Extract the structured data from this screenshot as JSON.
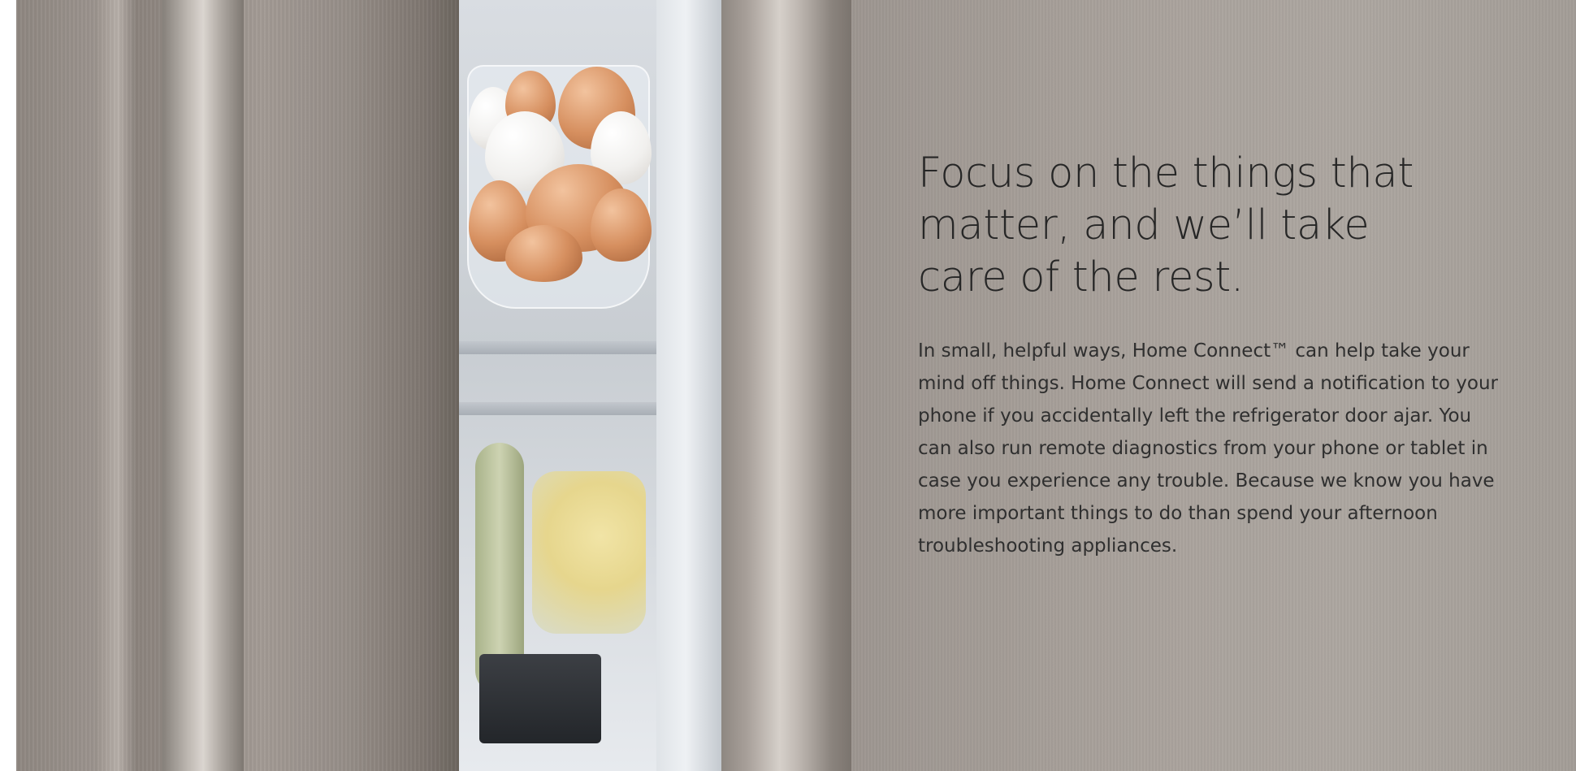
{
  "content": {
    "headline": "Focus on the things that matter, and we’ll take care of the rest.",
    "body": "In small, helpful ways, Home Connect™ can help take your mind off things. Home Connect will send a notification to your phone if you accidentally left the refrigerator door ajar. You can also run remote diagnostics from your phone or tablet in case you experience any trouble. Because we know you have more important things to do than spend your afternoon troubleshooting appliances."
  },
  "colors": {
    "text": "#2a2a2a",
    "steel": "#a59d97",
    "interior": "#d9dde2"
  }
}
